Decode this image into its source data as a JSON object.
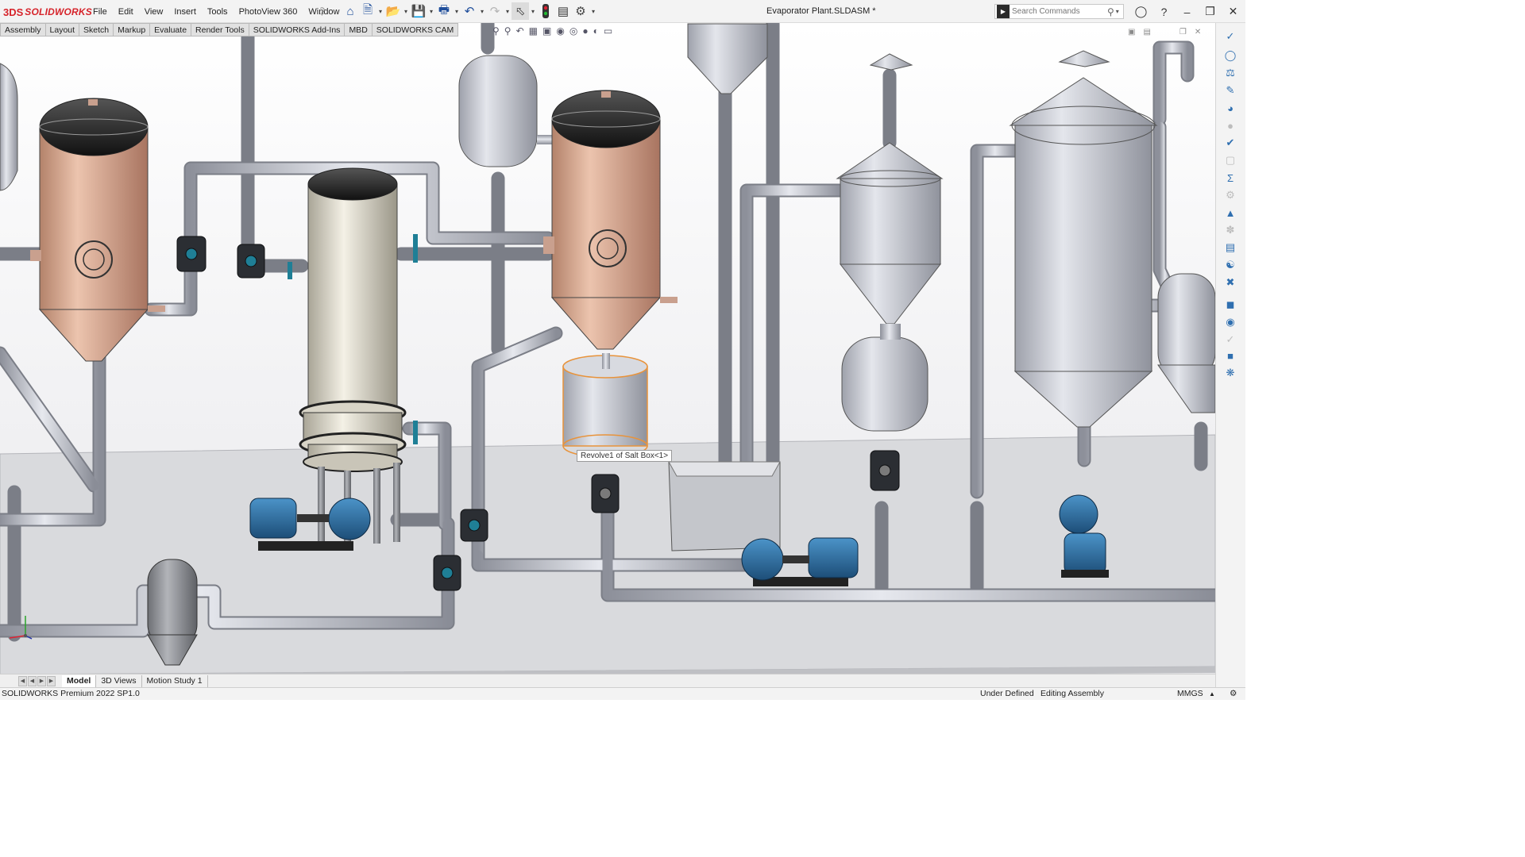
{
  "brand": {
    "ds": "3DS",
    "name": "SOLIDWORKS"
  },
  "menu": [
    "File",
    "Edit",
    "View",
    "Insert",
    "Tools",
    "PhotoView 360",
    "Window"
  ],
  "document_title": "Evaporator Plant.SLDASM *",
  "search": {
    "placeholder": "Search Commands"
  },
  "command_tabs": [
    "Assembly",
    "Layout",
    "Sketch",
    "Markup",
    "Evaluate",
    "Render Tools",
    "SOLIDWORKS Add-Ins",
    "MBD",
    "SOLIDWORKS CAM"
  ],
  "tooltip": "Revolve1 of Salt Box<1>",
  "model_tabs": {
    "model": "Model",
    "views3d": "3D Views",
    "motion": "Motion Study 1"
  },
  "status": {
    "product": "SOLIDWORKS Premium 2022 SP1.0",
    "definition": "Under Defined",
    "mode": "Editing Assembly",
    "units": "MMGS"
  },
  "colors": {
    "copper": "#cf9f84",
    "pipe": "#c4c7cf",
    "steel": "#c7c9d1",
    "cream": "#e4e0d2",
    "pump_blue": "#2f6fa0",
    "floor": "#d9dadd",
    "selection": "#e8933b",
    "brand_red": "#d6232a"
  }
}
